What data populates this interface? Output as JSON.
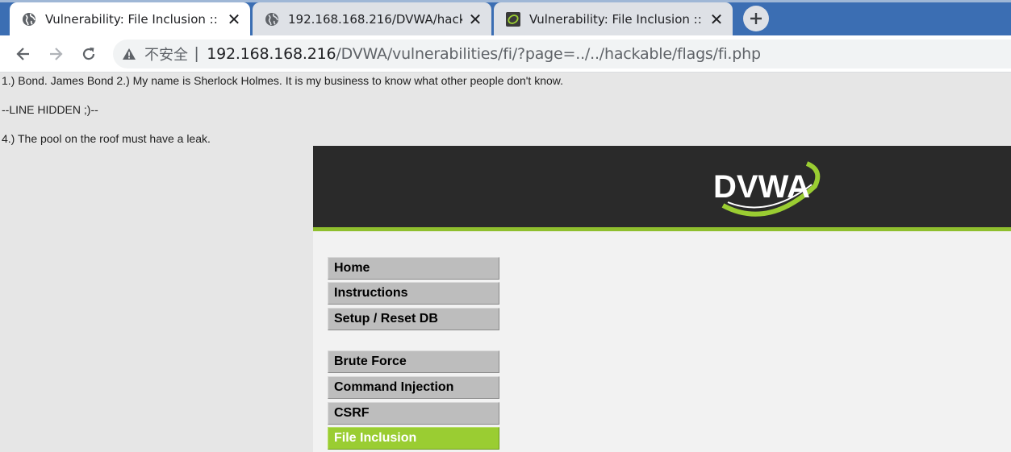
{
  "tabs": [
    {
      "title": "Vulnerability: File Inclusion :: D",
      "favicon": "globe-icon",
      "active": true
    },
    {
      "title": "192.168.168.216/DVWA/hacka",
      "favicon": "globe-icon",
      "active": false
    },
    {
      "title": "Vulnerability: File Inclusion :: D",
      "favicon": "dvwa-swirl-icon",
      "active": false
    }
  ],
  "toolbar": {
    "security_label": "不安全",
    "url_host": "192.168.168.216",
    "url_path": "/DVWA/vulnerabilities/fi/?page=../../hackable/flags/fi.php"
  },
  "included_file": {
    "line1": "1.) Bond. James Bond 2.) My name is Sherlock Holmes. It is my business to know what other people don't know.",
    "line2": "--LINE HIDDEN ;)--",
    "line3": "4.) The pool on the roof must have a leak."
  },
  "dvwa": {
    "logo_text": "DVWA",
    "menu": [
      {
        "label": "Home",
        "selected": false
      },
      {
        "label": "Instructions",
        "selected": false
      },
      {
        "label": "Setup / Reset DB",
        "selected": false
      },
      {
        "label": "Brute Force",
        "selected": false
      },
      {
        "label": "Command Injection",
        "selected": false
      },
      {
        "label": "CSRF",
        "selected": false
      },
      {
        "label": "File Inclusion",
        "selected": true
      }
    ]
  },
  "colors": {
    "tabstrip": "#3b6eb3",
    "dvwa_header": "#2a2a2a",
    "dvwa_accent": "#9acd32",
    "menu_button": "#bdbdbd"
  }
}
